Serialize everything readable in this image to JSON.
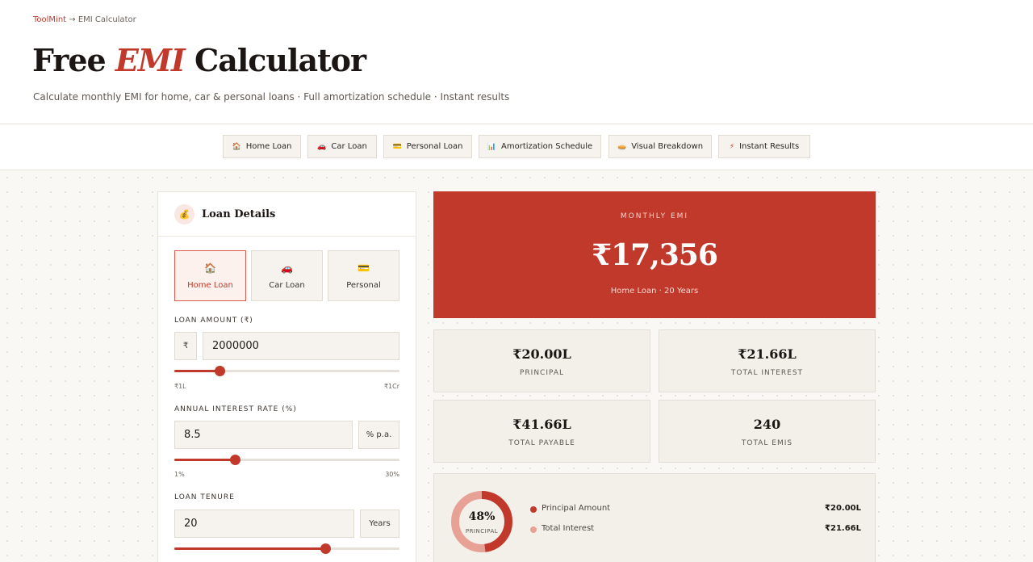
{
  "breadcrumb": {
    "home": "ToolMint",
    "separator": "→",
    "current": "EMI Calculator"
  },
  "title": {
    "prefix": "Free",
    "accent": "EMI",
    "suffix": "Calculator"
  },
  "subtitle": "Calculate monthly EMI for home, car & personal loans · Full amortization schedule · Instant results",
  "features": [
    {
      "icon": "house-icon",
      "glyph": "🏠",
      "label": "Home Loan"
    },
    {
      "icon": "car-icon",
      "glyph": "🚗",
      "label": "Car Loan"
    },
    {
      "icon": "card-icon",
      "glyph": "💳",
      "label": "Personal Loan"
    },
    {
      "icon": "bar-chart-icon",
      "glyph": "📊",
      "label": "Amortization Schedule"
    },
    {
      "icon": "pie-icon",
      "glyph": "🥧",
      "label": "Visual Breakdown"
    },
    {
      "icon": "lightning-icon",
      "glyph": "⚡",
      "label": "Instant Results"
    }
  ],
  "panel": {
    "icon": "money-bag-icon",
    "icon_glyph": "💰",
    "title": "Loan Details",
    "loan_types": [
      {
        "icon": "house-icon",
        "glyph": "🏠",
        "label": "Home Loan",
        "active": true
      },
      {
        "icon": "car-icon",
        "glyph": "🚗",
        "label": "Car Loan",
        "active": false
      },
      {
        "icon": "card-icon",
        "glyph": "💳",
        "label": "Personal",
        "active": false
      }
    ],
    "amount": {
      "label": "LOAN AMOUNT (₹)",
      "prefix": "₹",
      "value": "2000000",
      "min_label": "₹1L",
      "max_label": "₹1Cr",
      "slider_fraction": 0.2
    },
    "rate": {
      "label": "ANNUAL INTEREST RATE (%)",
      "value": "8.5",
      "suffix": "% p.a.",
      "min_label": "1%",
      "max_label": "30%",
      "slider_fraction": 0.27
    },
    "tenure": {
      "label": "LOAN TENURE",
      "value": "20",
      "suffix": "Years",
      "slider_fraction": 0.67
    }
  },
  "result": {
    "label": "MONTHLY EMI",
    "value": "₹17,356",
    "sub": "Home Loan · 20 Years"
  },
  "stats": [
    {
      "value": "₹20.00L",
      "label": "PRINCIPAL"
    },
    {
      "value": "₹21.66L",
      "label": "TOTAL INTEREST"
    },
    {
      "value": "₹41.66L",
      "label": "TOTAL PAYABLE"
    },
    {
      "value": "240",
      "label": "TOTAL EMIS"
    }
  ],
  "breakdown": {
    "percent": "48%",
    "caption": "PRINCIPAL",
    "principal_fraction": 0.48,
    "items": [
      {
        "label": "Principal Amount",
        "value": "₹20.00L",
        "color": "#c0392b"
      },
      {
        "label": "Total Interest",
        "value": "₹21.66L",
        "color": "#e8a195"
      }
    ]
  },
  "colors": {
    "accent": "#c0392b",
    "accent_light": "#e8a195",
    "page_bg": "#faf8f4"
  }
}
